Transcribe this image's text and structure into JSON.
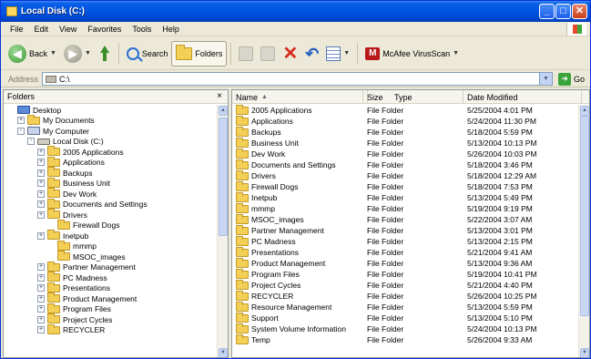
{
  "window": {
    "title": "Local Disk (C:)",
    "buttons": {
      "minimize": "_",
      "maximize": "□",
      "close": "✕"
    }
  },
  "menu": [
    "File",
    "Edit",
    "View",
    "Favorites",
    "Tools",
    "Help"
  ],
  "toolbar": {
    "back_label": "Back",
    "search_label": "Search",
    "folders_label": "Folders",
    "mcafee_label": "McAfee VirusScan"
  },
  "address": {
    "label": "Address",
    "value": "C:\\",
    "go_label": "Go"
  },
  "left_pane": {
    "title": "Folders",
    "close": "×",
    "tree": [
      {
        "label": "Desktop",
        "indent": 0,
        "toggle": "",
        "icon": "desktop-icon"
      },
      {
        "label": "My Documents",
        "indent": 1,
        "toggle": "+",
        "icon": "folder-icon"
      },
      {
        "label": "My Computer",
        "indent": 1,
        "toggle": "-",
        "icon": "computer-icon"
      },
      {
        "label": "Local Disk (C:)",
        "indent": 2,
        "toggle": "-",
        "icon": "disk-icon"
      },
      {
        "label": "2005 Applications",
        "indent": 3,
        "toggle": "+",
        "icon": "folder-icon"
      },
      {
        "label": "Applications",
        "indent": 3,
        "toggle": "+",
        "icon": "folder-icon"
      },
      {
        "label": "Backups",
        "indent": 3,
        "toggle": "+",
        "icon": "folder-icon"
      },
      {
        "label": "Business Unit",
        "indent": 3,
        "toggle": "+",
        "icon": "folder-icon"
      },
      {
        "label": "Dev Work",
        "indent": 3,
        "toggle": "+",
        "icon": "folder-icon"
      },
      {
        "label": "Documents and Settings",
        "indent": 3,
        "toggle": "+",
        "icon": "folder-icon"
      },
      {
        "label": "Drivers",
        "indent": 3,
        "toggle": "+",
        "icon": "folder-icon"
      },
      {
        "label": "Firewall Dogs",
        "indent": 4,
        "toggle": "",
        "icon": "folder-icon"
      },
      {
        "label": "Inetpub",
        "indent": 3,
        "toggle": "+",
        "icon": "folder-icon"
      },
      {
        "label": "mmmp",
        "indent": 4,
        "toggle": "",
        "icon": "folder-icon"
      },
      {
        "label": "MSOC_images",
        "indent": 4,
        "toggle": "",
        "icon": "folder-icon"
      },
      {
        "label": "Partner Management",
        "indent": 3,
        "toggle": "+",
        "icon": "folder-icon"
      },
      {
        "label": "PC Madness",
        "indent": 3,
        "toggle": "+",
        "icon": "folder-icon"
      },
      {
        "label": "Presentations",
        "indent": 3,
        "toggle": "+",
        "icon": "folder-icon"
      },
      {
        "label": "Product Management",
        "indent": 3,
        "toggle": "+",
        "icon": "folder-icon"
      },
      {
        "label": "Program Files",
        "indent": 3,
        "toggle": "+",
        "icon": "folder-icon"
      },
      {
        "label": "Project Cycles",
        "indent": 3,
        "toggle": "+",
        "icon": "folder-icon"
      },
      {
        "label": "RECYCLER",
        "indent": 3,
        "toggle": "+",
        "icon": "folder-icon"
      }
    ]
  },
  "right_pane": {
    "columns": {
      "name": "Name",
      "size": "Size",
      "type": "Type",
      "date": "Date Modified",
      "sort_indicator": "▲"
    },
    "files": [
      {
        "name": "2005 Applications",
        "type": "File Folder",
        "date": "5/25/2004 4:01 PM"
      },
      {
        "name": "Applications",
        "type": "File Folder",
        "date": "5/24/2004 11:30 PM"
      },
      {
        "name": "Backups",
        "type": "File Folder",
        "date": "5/18/2004 5:59 PM"
      },
      {
        "name": "Business Unit",
        "type": "File Folder",
        "date": "5/13/2004 10:13 PM"
      },
      {
        "name": "Dev Work",
        "type": "File Folder",
        "date": "5/26/2004 10:03 PM"
      },
      {
        "name": "Documents and Settings",
        "type": "File Folder",
        "date": "5/18/2004 3:46 PM"
      },
      {
        "name": "Drivers",
        "type": "File Folder",
        "date": "5/18/2004 12:29 AM"
      },
      {
        "name": "Firewall Dogs",
        "type": "File Folder",
        "date": "5/18/2004 7:53 PM"
      },
      {
        "name": "Inetpub",
        "type": "File Folder",
        "date": "5/13/2004 5:49 PM"
      },
      {
        "name": "mmmp",
        "type": "File Folder",
        "date": "5/19/2004 9:19 PM"
      },
      {
        "name": "MSOC_images",
        "type": "File Folder",
        "date": "5/22/2004 3:07 AM"
      },
      {
        "name": "Partner Management",
        "type": "File Folder",
        "date": "5/13/2004 3:01 PM"
      },
      {
        "name": "PC Madness",
        "type": "File Folder",
        "date": "5/13/2004 2:15 PM"
      },
      {
        "name": "Presentations",
        "type": "File Folder",
        "date": "5/21/2004 9:41 AM"
      },
      {
        "name": "Product Management",
        "type": "File Folder",
        "date": "5/13/2004 9:36 AM"
      },
      {
        "name": "Program Files",
        "type": "File Folder",
        "date": "5/19/2004 10:41 PM"
      },
      {
        "name": "Project Cycles",
        "type": "File Folder",
        "date": "5/21/2004 4:40 PM"
      },
      {
        "name": "RECYCLER",
        "type": "File Folder",
        "date": "5/26/2004 10:25 PM"
      },
      {
        "name": "Resource Management",
        "type": "File Folder",
        "date": "5/13/2004 5:59 PM"
      },
      {
        "name": "Support",
        "type": "File Folder",
        "date": "5/13/2004 5:10 PM"
      },
      {
        "name": "System Volume Information",
        "type": "File Folder",
        "date": "5/24/2004 10:13 PM"
      },
      {
        "name": "Temp",
        "type": "File Folder",
        "date": "5/26/2004 9:33 AM"
      }
    ]
  }
}
